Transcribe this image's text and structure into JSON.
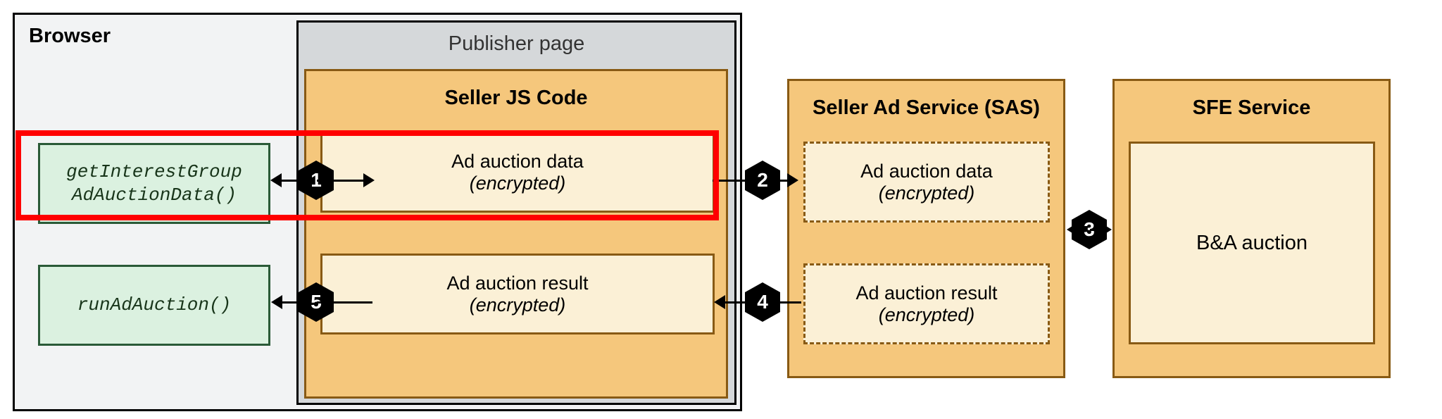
{
  "browser": {
    "title": "Browser",
    "api_calls": {
      "getIG": "getInterestGroup\nAdAuctionData()",
      "run": "runAdAuction()"
    }
  },
  "publisher": {
    "title": "Publisher page",
    "seller_js": {
      "title": "Seller JS Code",
      "data_box": {
        "line1": "Ad auction data",
        "line2": "(encrypted)"
      },
      "result_box": {
        "line1": "Ad auction result",
        "line2": "(encrypted)"
      }
    }
  },
  "sas": {
    "title": "Seller Ad Service (SAS)",
    "data_box": {
      "line1": "Ad auction data",
      "line2": "(encrypted)"
    },
    "result_box": {
      "line1": "Ad auction result",
      "line2": "(encrypted)"
    }
  },
  "sfe": {
    "title": "SFE Service",
    "auction_box": "B&A auction"
  },
  "steps": {
    "s1": "1",
    "s2": "2",
    "s3": "3",
    "s4": "4",
    "s5": "5"
  }
}
